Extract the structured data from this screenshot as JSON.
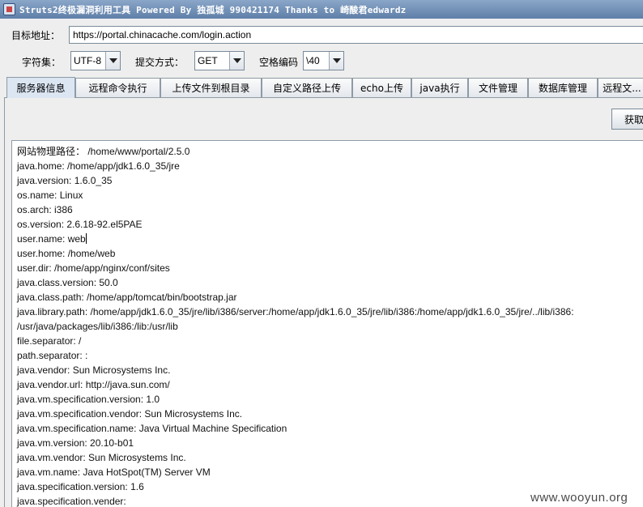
{
  "window": {
    "title": "Struts2终极漏洞利用工具   Powered By 独孤城 990421174 Thanks to 崎酸君edwardz"
  },
  "url": {
    "label": "目标地址：",
    "value": "https://portal.chinacache.com/login.action"
  },
  "options": {
    "charset_label": "字符集：",
    "charset_value": "UTF-8",
    "method_label": "提交方式：",
    "method_value": "GET",
    "space_label": "空格编码",
    "space_value": "\\40"
  },
  "tabs": [
    {
      "label": "服务器信息",
      "active": true
    },
    {
      "label": "远程命令执行"
    },
    {
      "label": "上传文件到根目录"
    },
    {
      "label": "自定义路径上传"
    },
    {
      "label": "echo上传"
    },
    {
      "label": "java执行"
    },
    {
      "label": "文件管理"
    },
    {
      "label": "数据库管理"
    },
    {
      "label": "远程文..."
    }
  ],
  "panel": {
    "fetch_button": "获取"
  },
  "output_lines": [
    "网站物理路径： /home/www/portal/2.5.0",
    "java.home: /home/app/jdk1.6.0_35/jre",
    "java.version: 1.6.0_35",
    "os.name: Linux",
    "os.arch: i386",
    "os.version: 2.6.18-92.el5PAE",
    "user.name: web",
    "user.home: /home/web",
    "user.dir: /home/app/nginx/conf/sites",
    "java.class.version: 50.0",
    "java.class.path: /home/app/tomcat/bin/bootstrap.jar",
    "java.library.path: /home/app/jdk1.6.0_35/jre/lib/i386/server:/home/app/jdk1.6.0_35/jre/lib/i386:/home/app/jdk1.6.0_35/jre/../lib/i386:",
    "/usr/java/packages/lib/i386:/lib:/usr/lib",
    "file.separator: /",
    "path.separator: :",
    "java.vendor: Sun Microsystems Inc.",
    "java.vendor.url: http://java.sun.com/",
    "java.vm.specification.version: 1.0",
    "java.vm.specification.vendor: Sun Microsystems Inc.",
    "java.vm.specification.name: Java Virtual Machine Specification",
    "java.vm.version: 20.10-b01",
    "java.vm.vendor: Sun Microsystems Inc.",
    "java.vm.name: Java HotSpot(TM) Server VM",
    "java.specification.version: 1.6",
    "java.specification.vender:"
  ],
  "watermark": "www.wooyun.org"
}
